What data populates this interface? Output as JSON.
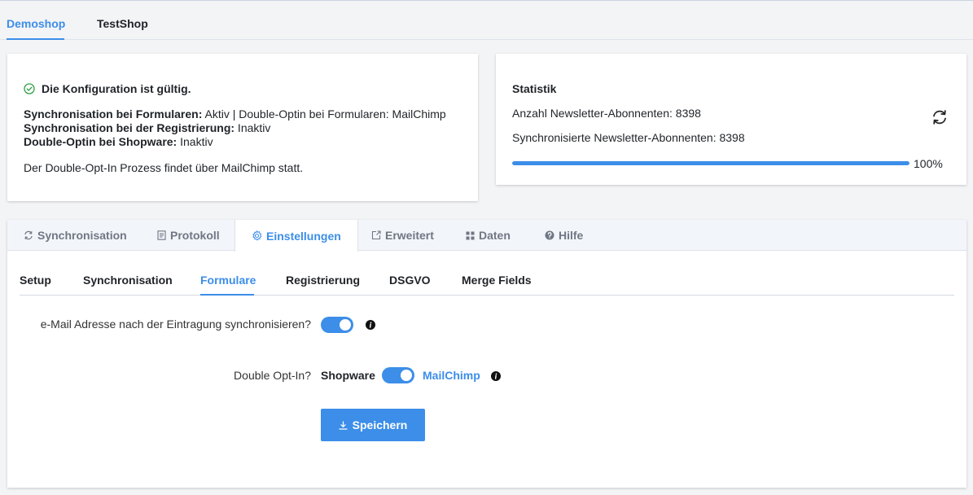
{
  "shop_tabs": [
    {
      "label": "Demoshop",
      "active": true
    },
    {
      "label": "TestShop",
      "active": false
    }
  ],
  "status": {
    "title": "Die Konfiguration ist gültig.",
    "line1_label": "Synchronisation bei Formularen:",
    "line1_value": " Aktiv | Double-Optin bei Formularen: MailChimp",
    "line2_label": "Synchronisation bei der Registrierung:",
    "line2_value": " Inaktiv",
    "line3_label": "Double-Optin bei Shopware:",
    "line3_value": " Inaktiv",
    "note": "Der Double-Opt-In Prozess findet über MailChimp statt."
  },
  "statistics": {
    "title": "Statistik",
    "subscribers": "Anzahl Newsletter-Abonnenten: 8398",
    "synced": "Synchronisierte Newsletter-Abonnenten: 8398",
    "progress_percent": 100,
    "progress_label": "100%"
  },
  "main_tabs": [
    {
      "label": "Synchronisation",
      "icon": "sync-icon",
      "active": false
    },
    {
      "label": "Protokoll",
      "icon": "document-icon",
      "active": false
    },
    {
      "label": "Einstellungen",
      "icon": "gear-icon",
      "active": true
    },
    {
      "label": "Erweitert",
      "icon": "external-icon",
      "active": false
    },
    {
      "label": "Daten",
      "icon": "grid-icon",
      "active": false
    },
    {
      "label": "Hilfe",
      "icon": "help-icon",
      "active": false
    }
  ],
  "sub_tabs": [
    {
      "label": "Setup",
      "active": false
    },
    {
      "label": "Synchronisation",
      "active": false
    },
    {
      "label": "Formulare",
      "active": true
    },
    {
      "label": "Registrierung",
      "active": false
    },
    {
      "label": "DSGVO",
      "active": false
    },
    {
      "label": "Merge Fields",
      "active": false
    }
  ],
  "form": {
    "sync_email_label": "e-Mail Adresse nach der Eintragung synchronisieren?",
    "sync_email_on": true,
    "double_optin_label": "Double Opt-In?",
    "option_left": "Shopware",
    "option_right": "MailChimp",
    "double_optin_mailchimp": true,
    "save_label": "Speichern"
  },
  "colors": {
    "accent": "#3c8ee8",
    "success": "#2f9e44"
  }
}
